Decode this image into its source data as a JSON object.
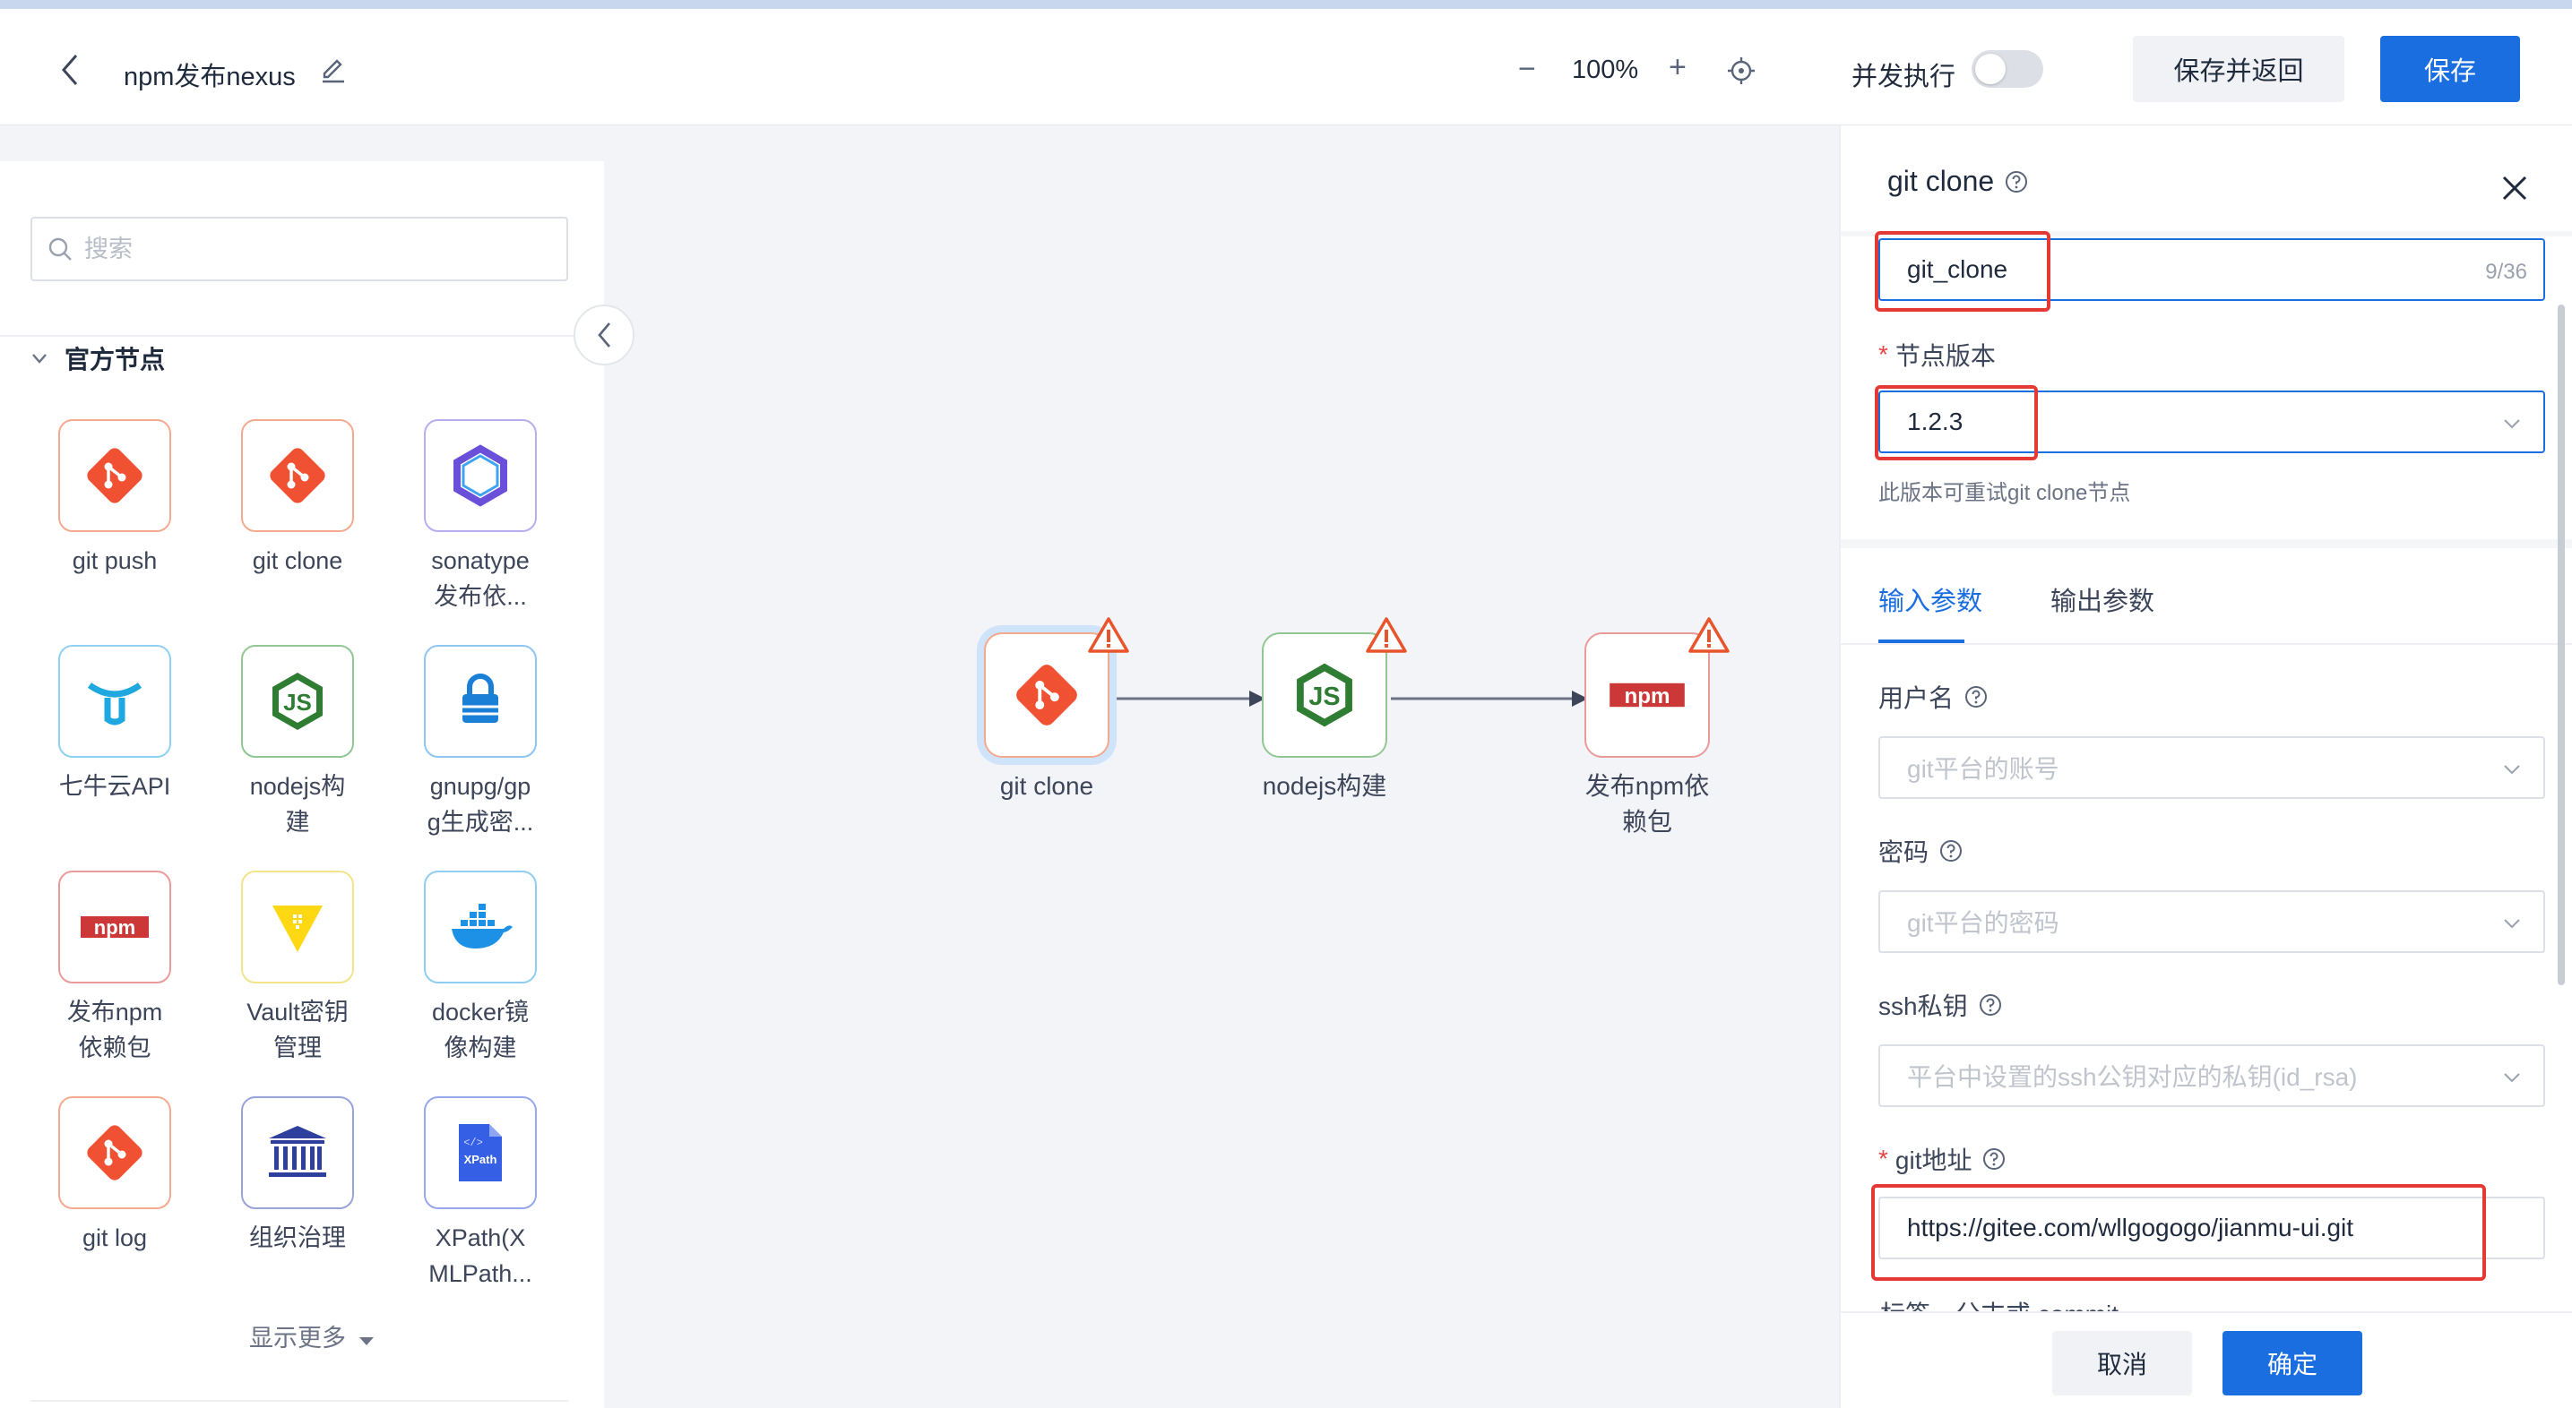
{
  "header": {
    "title": "npm发布nexus",
    "zoom": "100%",
    "zoom_out_symbol": "−",
    "zoom_in_symbol": "+",
    "concurrent_label": "并发执行",
    "concurrent_enabled": false,
    "save_return_label": "保存并返回",
    "save_label": "保存"
  },
  "sidebar": {
    "search_placeholder": "搜索",
    "section_title": "官方节点",
    "show_more": "显示更多",
    "nodes": [
      {
        "label": "git push",
        "icon": "git-icon"
      },
      {
        "label": "git clone",
        "icon": "git-icon"
      },
      {
        "label": "sonatype发布依...",
        "icon": "sonatype-icon"
      },
      {
        "label": "七牛云API",
        "icon": "qiniu-icon"
      },
      {
        "label": "nodejs构建",
        "icon": "nodejs-icon"
      },
      {
        "label": "gnupg/gpg生成密...",
        "icon": "gnupg-icon"
      },
      {
        "label": "发布npm依赖包",
        "icon": "npm-icon"
      },
      {
        "label": "Vault密钥管理",
        "icon": "vault-icon"
      },
      {
        "label": "docker镜像构建",
        "icon": "docker-icon"
      },
      {
        "label": "git log",
        "icon": "git-icon"
      },
      {
        "label": "组织治理",
        "icon": "bank-icon"
      },
      {
        "label": "XPath(XMLPath...",
        "icon": "xpath-icon"
      }
    ],
    "label_lines": [
      [
        "git push"
      ],
      [
        "git clone"
      ],
      [
        "sonatype",
        "发布依..."
      ],
      [
        "七牛云API"
      ],
      [
        "nodejs构",
        "建"
      ],
      [
        "gnupg/gp",
        "g生成密..."
      ],
      [
        "发布npm",
        "依赖包"
      ],
      [
        "Vault密钥",
        "管理"
      ],
      [
        "docker镜",
        "像构建"
      ],
      [
        "git log"
      ],
      [
        "组织治理"
      ],
      [
        "XPath(X",
        "MLPath..."
      ]
    ]
  },
  "canvas": {
    "nodes": [
      {
        "label": "git clone",
        "icon": "git-icon",
        "selected": true,
        "warning": true
      },
      {
        "label": "nodejs构建",
        "icon": "nodejs-icon",
        "selected": false,
        "warning": true
      },
      {
        "label_lines": [
          "发布npm依",
          "赖包"
        ],
        "label": "发布npm依赖包",
        "icon": "npm-icon",
        "selected": false,
        "warning": true
      }
    ]
  },
  "panel": {
    "title": "git clone",
    "name_value": "git_clone",
    "name_count": "9/36",
    "version_label": "节点版本",
    "version_value": "1.2.3",
    "version_hint": "此版本可重试git clone节点",
    "tab_input": "输入参数",
    "tab_output": "输出参数",
    "username_label": "用户名",
    "username_placeholder": "git平台的账号",
    "password_label": "密码",
    "password_placeholder": "git平台的密码",
    "ssh_label": "ssh私钥",
    "ssh_placeholder": "平台中设置的ssh公钥对应的私钥(id_rsa)",
    "git_url_label": "git地址",
    "git_url_value": "https://gitee.com/wllgogogo/jianmu-ui.git",
    "next_label_partial": "标签、分支或 commit",
    "cancel_label": "取消",
    "ok_label": "确定"
  },
  "colors": {
    "primary": "#1a6ee0",
    "git": "#f05133",
    "nodejs": "#2e7d32",
    "npm": "#cb3837",
    "sonatype": "#6a4fd8",
    "highlight_box": "#e53935",
    "warning": "#e8552d"
  }
}
